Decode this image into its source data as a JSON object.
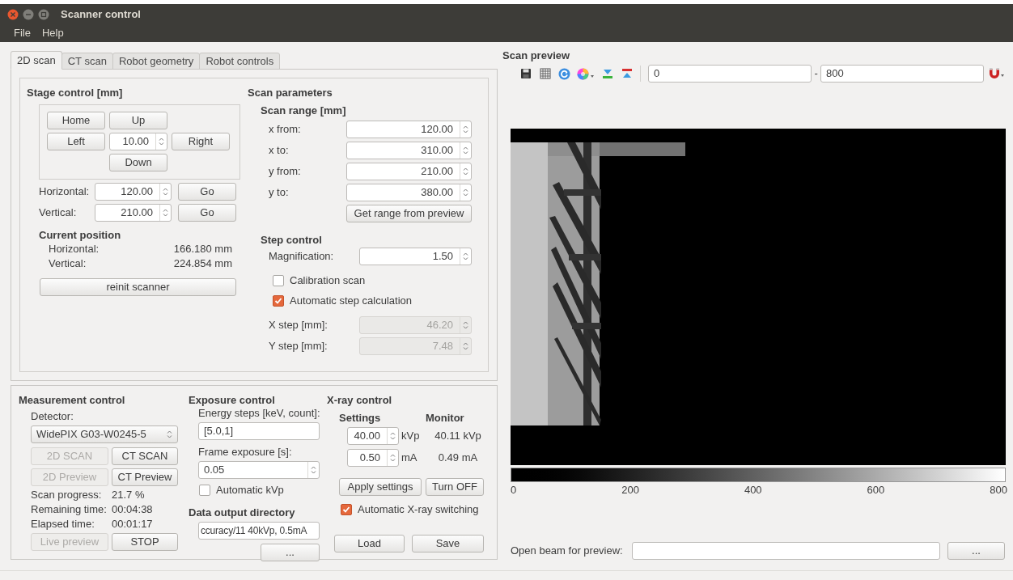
{
  "window": {
    "title": "Scanner control"
  },
  "menu": [
    "File",
    "Help"
  ],
  "tabs": [
    {
      "label": "2D scan",
      "selected": true
    },
    {
      "label": "CT scan",
      "selected": false
    },
    {
      "label": "Robot geometry",
      "selected": false
    },
    {
      "label": "Robot controls",
      "selected": false
    }
  ],
  "stage_control": {
    "title": "Stage control [mm]",
    "home": "Home",
    "up": "Up",
    "left": "Left",
    "step": "10.00",
    "right": "Right",
    "down": "Down",
    "moves": [
      {
        "label": "Horizontal:",
        "value": "120.00",
        "button": "Go"
      },
      {
        "label": "Vertical:",
        "value": "210.00",
        "button": "Go"
      }
    ],
    "current_position": {
      "title": "Current position",
      "rows": [
        {
          "label": "Horizontal:",
          "value": "166.180 mm"
        },
        {
          "label": "Vertical:",
          "value": "224.854 mm"
        }
      ]
    },
    "reinit_button": "reinit scanner"
  },
  "scan_parameters": {
    "title": "Scan parameters",
    "scan_range": {
      "title": "Scan range [mm]",
      "fields": [
        {
          "label": "x from:",
          "value": "120.00"
        },
        {
          "label": "x to:",
          "value": "310.00"
        },
        {
          "label": "y from:",
          "value": "210.00"
        },
        {
          "label": "y to:",
          "value": "380.00"
        }
      ],
      "button": "Get range from preview"
    },
    "step_control": {
      "title": "Step control",
      "magnification": {
        "label": "Magnification:",
        "value": "1.50"
      },
      "checkboxes": [
        {
          "label": "Calibration scan",
          "checked": false
        },
        {
          "label": "Automatic step calculation",
          "checked": true
        }
      ],
      "steps": [
        {
          "label": "X step [mm]:",
          "value": "46.20",
          "disabled": true
        },
        {
          "label": "Y step [mm]:",
          "value": "7.48",
          "disabled": true
        }
      ]
    }
  },
  "measurement_control": {
    "title": "Measurement control",
    "detector_label": "Detector:",
    "detector": "WidePIX G03-W0245-5",
    "buttons": [
      {
        "label": "2D SCAN",
        "disabled": true
      },
      {
        "label": "CT SCAN",
        "disabled": false
      },
      {
        "label": "2D Preview",
        "disabled": true
      },
      {
        "label": "CT Preview",
        "disabled": false
      }
    ],
    "stats": [
      {
        "label": "Scan progress:",
        "value": "21.7 %"
      },
      {
        "label": "Remaining time:",
        "value": "00:04:38"
      },
      {
        "label": "Elapsed time:",
        "value": "00:01:17"
      }
    ],
    "bottom_buttons": [
      {
        "label": "Live preview",
        "disabled": true
      },
      {
        "label": "STOP",
        "disabled": false
      }
    ]
  },
  "exposure_control": {
    "title": "Exposure control",
    "energy_label": "Energy steps [keV, count]:",
    "energy_value": "[5.0,1]",
    "frame_label": "Frame exposure [s]:",
    "frame_value": "0.05",
    "auto_kvp": {
      "label": "Automatic kVp",
      "checked": false
    }
  },
  "data_output": {
    "title": "Data output directory",
    "value": "ccuracy/11 40kVp, 0.5mA",
    "browse_button": "..."
  },
  "xray_control": {
    "title": "X-ray control",
    "settings_title": "Settings",
    "monitor_title": "Monitor",
    "rows": [
      {
        "value": "40.00",
        "unit": "kVp",
        "monitor": "40.11 kVp"
      },
      {
        "value": "0.50",
        "unit": "mA",
        "monitor": "0.49 mA"
      }
    ],
    "buttons": [
      "Apply settings",
      "Turn OFF"
    ],
    "auto_switch": {
      "label": "Automatic X-ray switching",
      "checked": true
    },
    "file_buttons": [
      "Load",
      "Save"
    ]
  },
  "scan_preview": {
    "title": "Scan preview",
    "range_min": "0",
    "range_separator": "-",
    "range_max": "800",
    "colorbar_ticks": [
      "0",
      "200",
      "400",
      "600",
      "800"
    ],
    "open_beam_label": "Open beam for preview:",
    "open_beam_browse": "..."
  }
}
